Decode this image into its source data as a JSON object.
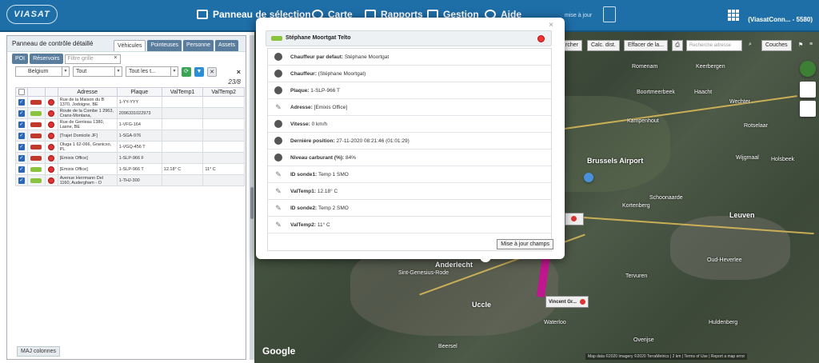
{
  "header": {
    "logo": "VIASAT",
    "nav": [
      {
        "label": "Panneau de sélection",
        "icon": "monitor-icon"
      },
      {
        "label": "Carte",
        "icon": "map-icon"
      },
      {
        "label": "Rapports",
        "icon": "report-icon"
      },
      {
        "label": "Gestion",
        "icon": "settings-icon"
      },
      {
        "label": "Aide",
        "icon": "help-icon"
      }
    ],
    "update_text": "mise à jour",
    "account": "(ViasatConn... - 5580)"
  },
  "left_panel": {
    "title": "Panneau de contrôle détaillé",
    "tabs": [
      "Véhicules",
      "Pointeuses",
      "Personne",
      "Assets"
    ],
    "buttons": [
      "POI",
      "Réservoirs"
    ],
    "filter_placeholder": "Filtre grille",
    "filter_clear": "×",
    "country": "Belgium",
    "status": "Tout",
    "type": "Tout les t...",
    "count": "23/8",
    "close": "×",
    "columns": [
      "Adresse",
      "Plaque",
      "ValTemp1",
      "ValTemp2"
    ],
    "rows": [
      {
        "addr": "Rue de la Maison du B 1370, Jodoigne, BE",
        "plate": "1-YY-YYY",
        "t1": "",
        "t2": "",
        "color": "#c0392b"
      },
      {
        "addr": "Route de la Combe 1 2963, Crans-Montana,",
        "plate": "2096331022973",
        "t1": "",
        "t2": "",
        "color": "#8ac43e"
      },
      {
        "addr": "Rue de Genleau 1380, Lasne, BE",
        "plate": "1-VFG-164",
        "t1": "",
        "t2": "",
        "color": "#c0392b"
      },
      {
        "addr": "[Trajet Domicile JF]",
        "plate": "1-SGA-976",
        "t1": "",
        "t2": "",
        "color": "#c0392b"
      },
      {
        "addr": "Oluga 1 62-066, Granicxo, PL",
        "plate": "1-VGQ-456 T",
        "t1": "",
        "t2": "",
        "color": "#c0392b"
      },
      {
        "addr": "[Emixis Office]",
        "plate": "1-SLP-966 F",
        "t1": "",
        "t2": "",
        "color": "#c0392b"
      },
      {
        "addr": "[Emixis Office]",
        "plate": "1-SLP-966 T",
        "t1": "12.18° C",
        "t2": "11° C",
        "color": "#8ac43e"
      },
      {
        "addr": "Avenue Herrmann Del 1160, Audergham - O",
        "plate": "1-THJ-300",
        "t1": "",
        "t2": "",
        "color": "#8ac43e"
      }
    ],
    "maj_colonnes": "MAJ colonnes"
  },
  "map": {
    "toolbar": [
      "rcher",
      "Calc. dist.",
      "Effacer de la..."
    ],
    "search_placeholder": "Recherche adresse",
    "couches": "Couches",
    "labels": [
      {
        "t": "Romenam",
        "big": false
      },
      {
        "t": "Keerbergen",
        "big": false
      },
      {
        "t": "Boortmeerbeek",
        "big": false
      },
      {
        "t": "Haacht",
        "big": false
      },
      {
        "t": "Wechter",
        "big": false
      },
      {
        "t": "Kampenhout",
        "big": false
      },
      {
        "t": "Rotselaar",
        "big": false
      },
      {
        "t": "Brussels Airport",
        "big": true
      },
      {
        "t": "Wijgmaal",
        "big": false
      },
      {
        "t": "Holsbeek",
        "big": false
      },
      {
        "t": "Schoonaarde",
        "big": false
      },
      {
        "t": "Kortenberg",
        "big": false
      },
      {
        "t": "Leuven",
        "big": true
      },
      {
        "t": "Anderlecht",
        "big": true
      },
      {
        "t": "Uccle",
        "big": true
      },
      {
        "t": "Tervuren",
        "big": false
      },
      {
        "t": "Oud-Heverlee",
        "big": false
      },
      {
        "t": "Waterloo",
        "big": false
      },
      {
        "t": "Overijse",
        "big": false
      },
      {
        "t": "Sint-Genesius-Rode",
        "big": false
      },
      {
        "t": "Huldenberg",
        "big": false
      },
      {
        "t": "Beersel",
        "big": false
      }
    ],
    "marker1_label": "Vincent Gr...",
    "google": "Google",
    "attribution": "Map data ©2020 Imagery ©2020 TerraMetrics | 2 km | Terms of Use | Report a map error"
  },
  "modal": {
    "close": "×",
    "title": "Stéphane Moortgat Telto",
    "fields": [
      {
        "label": "Chauffeur par defaut:",
        "value": "Stéphane Moortgat",
        "icon": "driver-icon"
      },
      {
        "label": "Chauffeur:",
        "value": "(Stéphane Moortgat)",
        "icon": "driver-icon"
      },
      {
        "label": "Plaque:",
        "value": "1-SLP-966 T",
        "icon": "plate-icon"
      },
      {
        "label": "Adresse:",
        "value": "[Emixis Office]",
        "icon": "pin-icon"
      },
      {
        "label": "Vitesse:",
        "value": "0 km/h",
        "icon": "speedometer-icon"
      },
      {
        "label": "Dernière position:",
        "value": "27-11-2020 08:21:46 (01:01:29)",
        "icon": "calendar-icon"
      },
      {
        "label": "Niveau carburant (%):",
        "value": "84%",
        "icon": "fuel-icon"
      },
      {
        "label": "ID sonde1:",
        "value": "Temp 1 SMO",
        "icon": "pin-icon"
      },
      {
        "label": "ValTemp1:",
        "value": "12.18° C",
        "icon": "pin-icon"
      },
      {
        "label": "ID sonde2:",
        "value": "Temp 2 SMO",
        "icon": "pin-icon"
      },
      {
        "label": "ValTemp2:",
        "value": "11° C",
        "icon": "pin-icon"
      }
    ],
    "update_button": "Mise à jour champs"
  }
}
